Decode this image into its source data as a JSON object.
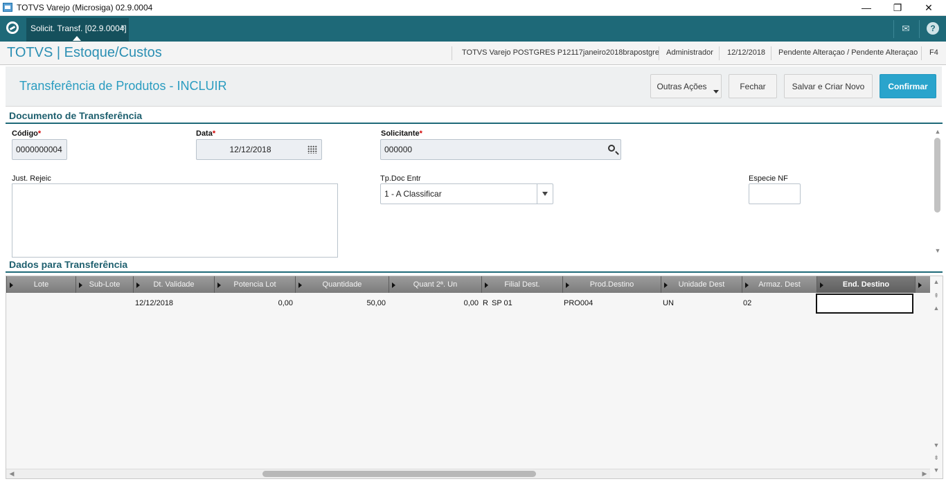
{
  "window": {
    "title": "TOTVS Varejo (Microsiga) 02.9.0004",
    "minimize": "—",
    "restore": "❐",
    "close": "✕"
  },
  "tabbar": {
    "tab_label": "Solicit. Transf. [02.9.0004]",
    "tab_close": "×",
    "mail_icon": "✉",
    "help_icon": "?"
  },
  "module": {
    "brand": "TOTVS | Estoque/Custos",
    "environment": "TOTVS Varejo POSTGRES P12117janeiro2018brapostgre",
    "user": "Administrador",
    "date": "12/12/2018",
    "status": "Pendente Alteraçao / Pendente Alteraçao",
    "shortcut": "F4"
  },
  "page": {
    "title": "Transferência de Produtos - INCLUIR",
    "buttons": {
      "other_actions": "Outras Ações",
      "close": "Fechar",
      "save_new": "Salvar e Criar Novo",
      "confirm": "Confirmar"
    }
  },
  "document": {
    "section_title": "Documento de Transferência",
    "codigo": {
      "label": "Código",
      "value": "0000000004",
      "required": "*"
    },
    "data": {
      "label": "Data",
      "value": "12/12/2018",
      "required": "*"
    },
    "solicitante": {
      "label": "Solicitante",
      "value": "000000",
      "required": "*"
    },
    "just_rejeic": {
      "label": "Just. Rejeic",
      "value": ""
    },
    "tp_doc_entr": {
      "label": "Tp.Doc Entr",
      "value": "1 - A Classificar"
    },
    "especie_nf": {
      "label": "Especie NF",
      "value": ""
    }
  },
  "transfer": {
    "section_title": "Dados para Transferência",
    "columns": [
      "Lote",
      "Sub-Lote",
      "Dt. Validade",
      "Potencia Lot",
      "Quantidade",
      "Quant 2ª. Un",
      "Filial Dest.",
      "Prod.Destino",
      "Unidade Dest",
      "Armaz. Dest",
      "End. Destino"
    ],
    "rows": [
      {
        "dt_validade": "12/12/2018",
        "potencia": "0,00",
        "quantidade": "50,00",
        "quant2": "0,00",
        "filial_flag": "R",
        "filial": "SP 01",
        "produto": "PRO004",
        "unidade": "UN",
        "armazem": "02",
        "endereco": ""
      }
    ]
  }
}
